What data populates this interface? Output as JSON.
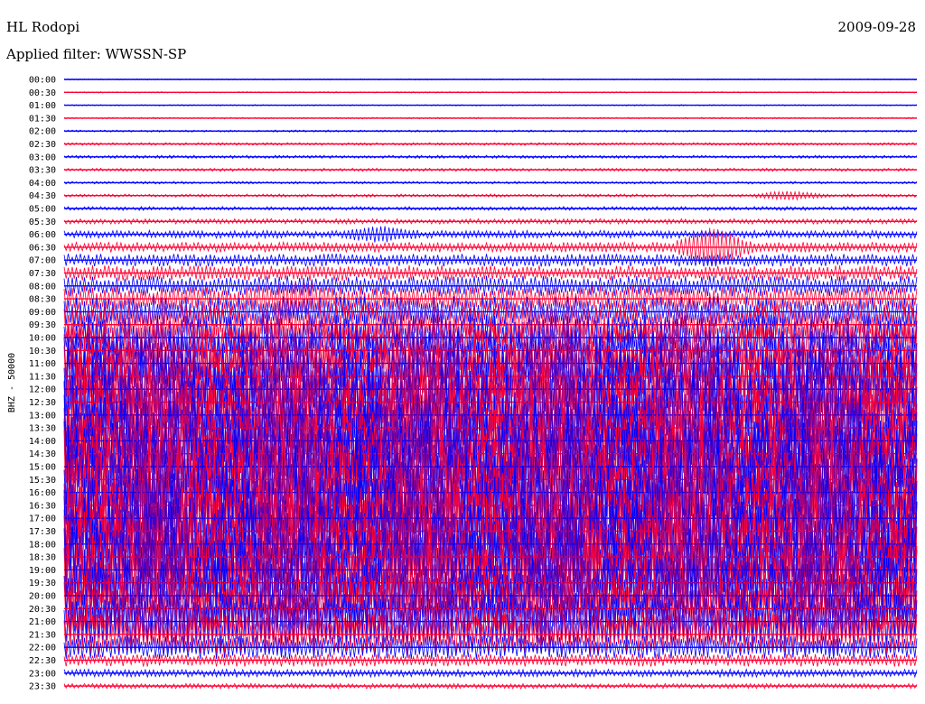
{
  "header": {
    "station": "HL Rodopi",
    "filter": "Applied filter: WWSSN-SP",
    "date": "2009-09-28"
  },
  "chart_data": {
    "type": "line",
    "title": "HL Rodopi",
    "ylabel": "BHZ - 50000",
    "row_labels": [
      "00:00",
      "00:30",
      "01:00",
      "01:30",
      "02:00",
      "02:30",
      "03:00",
      "03:30",
      "04:00",
      "04:30",
      "05:00",
      "05:30",
      "06:00",
      "06:30",
      "07:00",
      "07:30",
      "08:00",
      "08:30",
      "09:00",
      "09:30",
      "10:00",
      "10:30",
      "11:00",
      "11:30",
      "12:00",
      "12:30",
      "13:00",
      "13:30",
      "14:00",
      "14:30",
      "15:00",
      "15:30",
      "16:00",
      "16:30",
      "17:00",
      "17:30",
      "18:00",
      "18:30",
      "19:00",
      "19:30",
      "20:00",
      "20:30",
      "21:00",
      "21:30",
      "22:00",
      "22:30",
      "23:00",
      "23:30"
    ],
    "colors": {
      "even_rows": "#0000ff",
      "odd_rows": "#ff0033",
      "text": "#000000",
      "background": "#ffffff"
    },
    "row_amplitude": [
      0.05,
      0.05,
      0.05,
      0.06,
      0.08,
      0.1,
      0.12,
      0.12,
      0.1,
      0.12,
      0.15,
      0.2,
      0.3,
      0.4,
      0.5,
      0.6,
      0.8,
      1.0,
      1.2,
      1.5,
      1.8,
      2.2,
      2.6,
      3.0,
      3.4,
      3.6,
      3.8,
      3.8,
      3.6,
      3.6,
      3.8,
      4.0,
      4.2,
      4.2,
      4.2,
      4.0,
      3.8,
      3.6,
      3.4,
      3.2,
      3.0,
      2.6,
      2.2,
      1.6,
      0.9,
      0.5,
      0.3,
      0.2
    ],
    "events": [
      {
        "row": 13,
        "position": 0.76,
        "amplitude": 1.2
      },
      {
        "row": 17,
        "position": 0.27,
        "amplitude": 0.5
      },
      {
        "row": 12,
        "position": 0.37,
        "amplitude": 0.4
      },
      {
        "row": 9,
        "position": 0.85,
        "amplitude": 0.25
      }
    ]
  }
}
